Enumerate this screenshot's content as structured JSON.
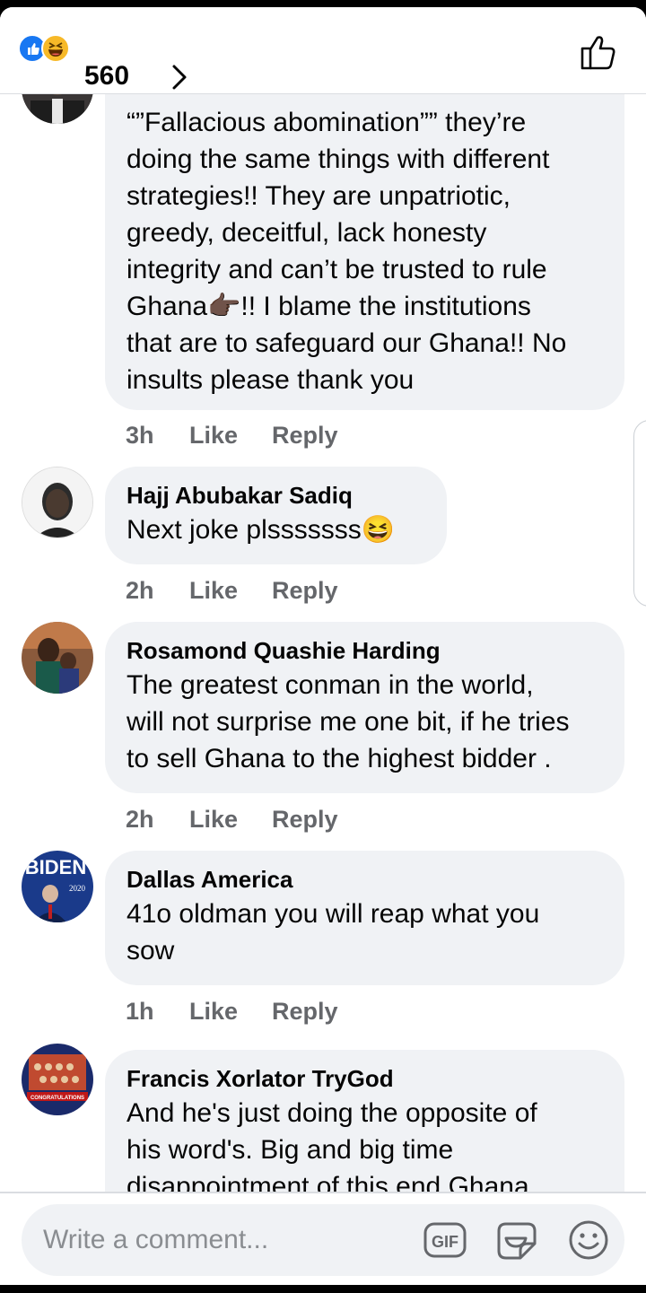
{
  "header": {
    "reaction_icons": [
      "like-icon",
      "haha-icon"
    ],
    "reaction_count": "560"
  },
  "comments": [
    {
      "author": "",
      "text": "“”Fallacious abomination”” they’re\ndoing the same things with different\nstrategies!! They are unpatriotic,\ngreedy, deceitful, lack honesty\nintegrity  and can’t be trusted to rule\nGhana👉🏿!! I blame the institutions\nthat are to safeguard our Ghana!! No\ninsults please thank you",
      "time": "3h",
      "like": "Like",
      "reply": "Reply"
    },
    {
      "author": "Hajj Abubakar Sadiq",
      "text": "Next joke plsssssss😆",
      "time": "2h",
      "like": "Like",
      "reply": "Reply"
    },
    {
      "author": "Rosamond Quashie Harding",
      "text": "The greatest conman in the world,\nwill not surprise me one bit, if he tries\nto sell Ghana to the highest bidder .",
      "time": "2h",
      "like": "Like",
      "reply": "Reply"
    },
    {
      "author": "Dallas America",
      "text": "41o oldman you will reap what you\nsow",
      "time": "1h",
      "like": "Like",
      "reply": "Reply",
      "avatar_text": "BIDEN",
      "avatar_year": "2020"
    },
    {
      "author": "Francis Xorlator TryGod",
      "text": "And he's just doing the opposite of\nhis word's. Big and big time\ndisappointment of this end Ghana.",
      "time": "",
      "like": "",
      "reply": "",
      "avatar_text": "CONGRATULATIONS"
    }
  ],
  "composer": {
    "placeholder": "Write a comment...",
    "gif_label": "GIF",
    "icons": [
      "gif-icon",
      "sticker-icon",
      "emoji-icon"
    ]
  },
  "colors": {
    "accent": "#1877f2",
    "bubble": "#f0f2f5",
    "meta_text": "#65676b"
  }
}
